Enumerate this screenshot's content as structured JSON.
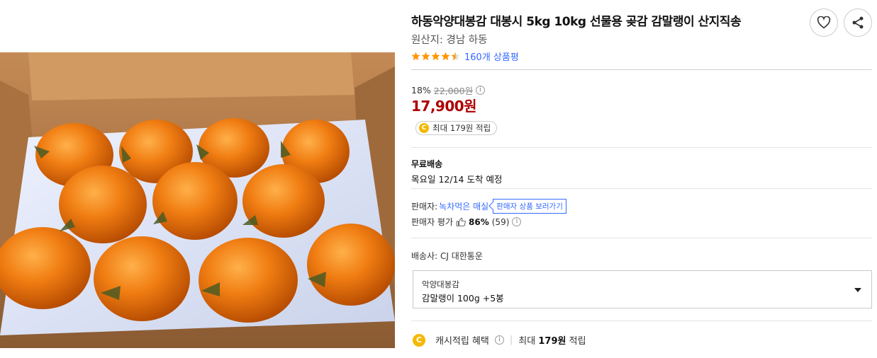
{
  "product": {
    "title": "하동악양대봉감 대봉시 5kg 10kg 선물용 곶감 감말랭이 산지직송",
    "origin": "원산지: 경남 하동",
    "rating": 4.5,
    "review_count_label": "160개 상품평"
  },
  "actions": {
    "favorite_icon": "heart-icon",
    "share_icon": "share-icon"
  },
  "price": {
    "discount_rate": "18%",
    "original_price": "22,000원",
    "sale_price": "17,900원",
    "cash_badge": "최대 179원 적립",
    "coin_symbol": "C"
  },
  "shipping": {
    "title": "무료배송",
    "arrival": "목요일 12/14 도착 예정"
  },
  "seller": {
    "label": "판매자:",
    "name": "녹차먹은 매실",
    "view_products": "판매자 상품 보러가기",
    "rating_label": "판매자 평가",
    "rating_pct": "86%",
    "rating_count": "(59)"
  },
  "carrier": "배송사: CJ 대한통운",
  "option": {
    "label": "악양대봉감",
    "value": "감말랭이 100g +5봉"
  },
  "cash_benefit": {
    "label": "캐시적립 혜택",
    "prefix": "최대",
    "amount": "179원",
    "suffix": "적립"
  },
  "colors": {
    "price_red": "#ae0000",
    "link_blue": "#346aff",
    "star_orange": "#ff9600",
    "coin_yellow": "#f5b800"
  }
}
